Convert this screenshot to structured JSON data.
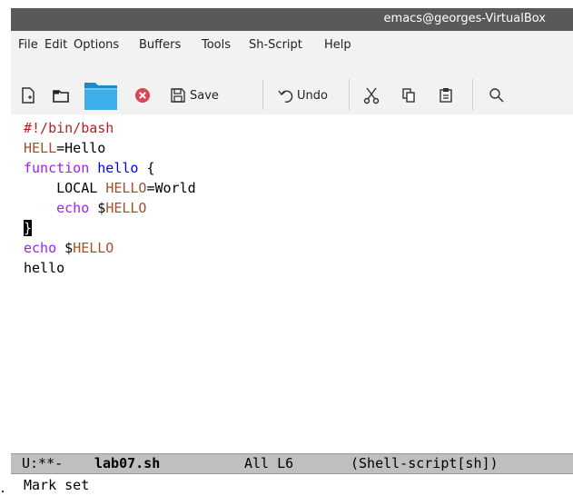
{
  "window": {
    "title": "emacs@georges-VirtualBox"
  },
  "menubar": [
    "File",
    "Edit",
    "Options",
    "Buffers",
    "Tools",
    "Sh-Script",
    "Help"
  ],
  "toolbar": {
    "save_label": "Save",
    "undo_label": "Undo"
  },
  "buffer": {
    "lines": [
      [
        {
          "t": "#!/bin/bash",
          "c": "comment"
        }
      ],
      [
        {
          "t": "HELL",
          "c": "var"
        },
        {
          "t": "=Hello",
          "c": "norm"
        }
      ],
      [
        {
          "t": "function",
          "c": "kw"
        },
        {
          "t": " ",
          "c": "norm"
        },
        {
          "t": "hello",
          "c": "fn"
        },
        {
          "t": " {",
          "c": "norm"
        }
      ],
      [
        {
          "t": "    LOCAL ",
          "c": "norm"
        },
        {
          "t": "HELLO",
          "c": "var"
        },
        {
          "t": "=World",
          "c": "norm"
        }
      ],
      [
        {
          "t": "    ",
          "c": "norm"
        },
        {
          "t": "echo",
          "c": "kw"
        },
        {
          "t": " $",
          "c": "norm"
        },
        {
          "t": "HELLO",
          "c": "var"
        }
      ],
      [
        {
          "t": "}",
          "c": "cursor"
        }
      ],
      [
        {
          "t": "echo",
          "c": "kw"
        },
        {
          "t": " $",
          "c": "norm"
        },
        {
          "t": "HELLO",
          "c": "var"
        }
      ],
      [
        {
          "t": "hello",
          "c": "norm"
        }
      ]
    ]
  },
  "modeline": {
    "status": "U:**-",
    "buffer_name": "lab07.sh",
    "position": "All L6",
    "mode": "(Shell-script[sh])"
  },
  "echo_area": "Mark set"
}
